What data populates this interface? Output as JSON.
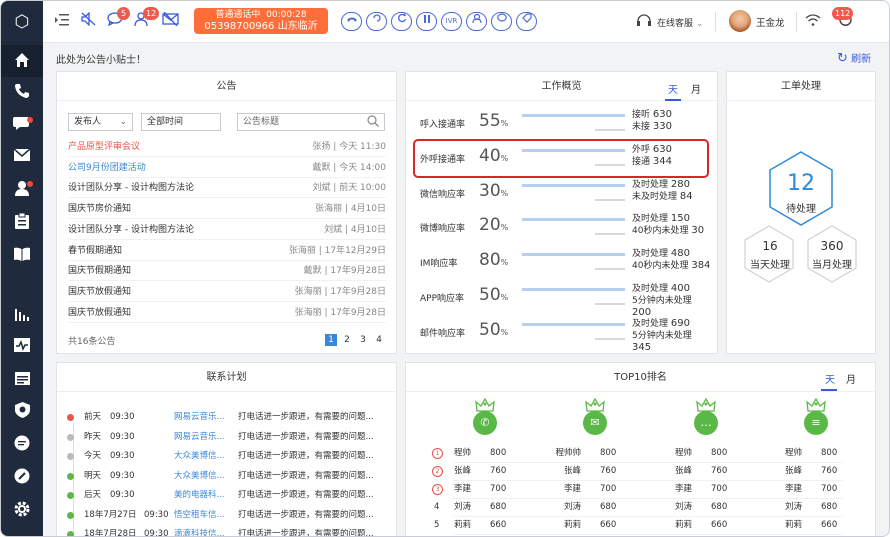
{
  "header": {
    "badges": {
      "chat": "5",
      "contacts": "12",
      "power": "112"
    },
    "call": {
      "status": "普通通话中",
      "timer": "00:00:28",
      "number": "05398700966",
      "location": "山东临沂"
    },
    "ivr_label": "IVR",
    "agent_status": "在线客服",
    "user_name": "王金龙"
  },
  "notice_bar": {
    "text": "此处为公告小贴士！",
    "refresh_label": "刷新"
  },
  "announcements": {
    "title": "公告",
    "filters": {
      "publisher": "发布人",
      "time": "全部时间",
      "title_placeholder": "公告标题"
    },
    "items": [
      {
        "title": "产品原型评审会议",
        "meta": "张扬 | 今天 11:30",
        "color": "#e8574d"
      },
      {
        "title": "公司9月份团建活动",
        "meta": "戴默 | 今天 14:00",
        "color": "#3a87d6"
      },
      {
        "title": "设计团队分享 - 设计构图方法论",
        "meta": "刘斌 | 前天 10:00",
        "color": "#333333"
      },
      {
        "title": "国庆节房价通知",
        "meta": "张海丽 | 4月10日",
        "color": "#333333"
      },
      {
        "title": "设计团队分享 - 设计构图方法论",
        "meta": "刘斌 | 4月10日",
        "color": "#333333"
      },
      {
        "title": "春节假期通知",
        "meta": "张海丽 | 17年12月29日",
        "color": "#333333"
      },
      {
        "title": "国庆节假期通知",
        "meta": "戴默 | 17年9月28日",
        "color": "#333333"
      },
      {
        "title": "国庆节放假通知",
        "meta": "张海丽 | 17年9月28日",
        "color": "#333333"
      },
      {
        "title": "国庆节放假通知",
        "meta": "张海丽 | 17年9月28日",
        "color": "#333333"
      }
    ],
    "total": "共16条公告",
    "pages": [
      "1",
      "2",
      "3",
      "4"
    ]
  },
  "work_overview": {
    "title": "工作概览",
    "tabs": {
      "day": "天",
      "month": "月"
    },
    "rows": [
      {
        "label": "呼入接通率",
        "value": "55",
        "unit": "%",
        "l1": "接听",
        "v1": "630",
        "l2": "未接",
        "v2": "330"
      },
      {
        "label": "外呼接通率",
        "value": "40",
        "unit": "%",
        "l1": "外呼",
        "v1": "630",
        "l2": "接通",
        "v2": "344"
      },
      {
        "label": "微信响应率",
        "value": "30",
        "unit": "%",
        "l1": "及时处理",
        "v1": "280",
        "l2": "未及时处理",
        "v2": "84"
      },
      {
        "label": "微博响应率",
        "value": "20",
        "unit": "%",
        "l1": "及时处理",
        "v1": "150",
        "l2": "40秒内未处理",
        "v2": "30"
      },
      {
        "label": "IM响应率",
        "value": "80",
        "unit": "%",
        "l1": "及时处理",
        "v1": "480",
        "l2": "40秒内未处理",
        "v2": "384"
      },
      {
        "label": "APP响应率",
        "value": "50",
        "unit": "%",
        "l1": "及时处理",
        "v1": "400",
        "l2": "5分钟内未处理",
        "v2": "200"
      },
      {
        "label": "邮件响应率",
        "value": "50",
        "unit": "%",
        "l1": "及时处理",
        "v1": "690",
        "l2": "5分钟内未处理",
        "v2": "345"
      }
    ]
  },
  "tickets": {
    "title": "工单处理",
    "pending_count": "12",
    "pending_label": "待处理",
    "today_count": "16",
    "today_label": "当天处理",
    "month_count": "360",
    "month_label": "当月处理"
  },
  "contact_plan": {
    "title": "联系计划",
    "items": [
      {
        "day": "前天",
        "time": "09:30",
        "company": "网易云音乐...",
        "note": "打电话进一步跟进，有需要的问题...",
        "dot": "#e8574d"
      },
      {
        "day": "昨天",
        "time": "09:30",
        "company": "网易云音乐...",
        "note": "打电话进一步跟进，有需要的问题...",
        "dot": "#bbbbbb"
      },
      {
        "day": "今天",
        "time": "09:30",
        "company": "大众美博信...",
        "note": "打电话进一步跟进，有需要的问题...",
        "dot": "#bbbbbb"
      },
      {
        "day": "明天",
        "time": "09:30",
        "company": "大众美博信...",
        "note": "打电话进一步跟进，有需要的问题...",
        "dot": "#5ab946"
      },
      {
        "day": "后天",
        "time": "09:30",
        "company": "美的电器科...",
        "note": "打电话进一步跟进，有需要的问题...",
        "dot": "#5ab946"
      },
      {
        "day": "18年7月27日",
        "time": "09:30",
        "company": "悟空租车信...",
        "note": "打电话进一步跟进，有需要的问题...",
        "dot": "#5ab946"
      },
      {
        "day": "18年7月28日",
        "time": "09:30",
        "company": "滴滴科技信...",
        "note": "打电话进一步跟进，有需要的问题...",
        "dot": "#5ab946"
      }
    ]
  },
  "top10": {
    "title": "TOP10排名",
    "tabs": {
      "day": "天",
      "month": "月"
    },
    "ranks": [
      "1",
      "2",
      "3",
      "4",
      "5"
    ],
    "columns": [
      {
        "icon": "phone-icon",
        "glyph": "✆",
        "rows": [
          [
            "程帅",
            "800"
          ],
          [
            "张峰",
            "760"
          ],
          [
            "李建",
            "700"
          ],
          [
            "刘涛",
            "680"
          ],
          [
            "莉莉",
            "660"
          ]
        ]
      },
      {
        "icon": "mail-icon",
        "glyph": "✉",
        "rows": [
          [
            "程帅帅",
            "800"
          ],
          [
            "张峰",
            "760"
          ],
          [
            "李建",
            "700"
          ],
          [
            "刘涛",
            "680"
          ],
          [
            "莉莉",
            "660"
          ]
        ]
      },
      {
        "icon": "chat-icon",
        "glyph": "…",
        "rows": [
          [
            "程帅",
            "800"
          ],
          [
            "张峰",
            "760"
          ],
          [
            "李建",
            "700"
          ],
          [
            "刘涛",
            "680"
          ],
          [
            "莉莉",
            "660"
          ]
        ]
      },
      {
        "icon": "list-icon",
        "glyph": "≡",
        "rows": [
          [
            "程帅",
            "800"
          ],
          [
            "张峰",
            "760"
          ],
          [
            "李建",
            "700"
          ],
          [
            "刘涛",
            "680"
          ],
          [
            "莉莉",
            "660"
          ]
        ]
      }
    ]
  }
}
